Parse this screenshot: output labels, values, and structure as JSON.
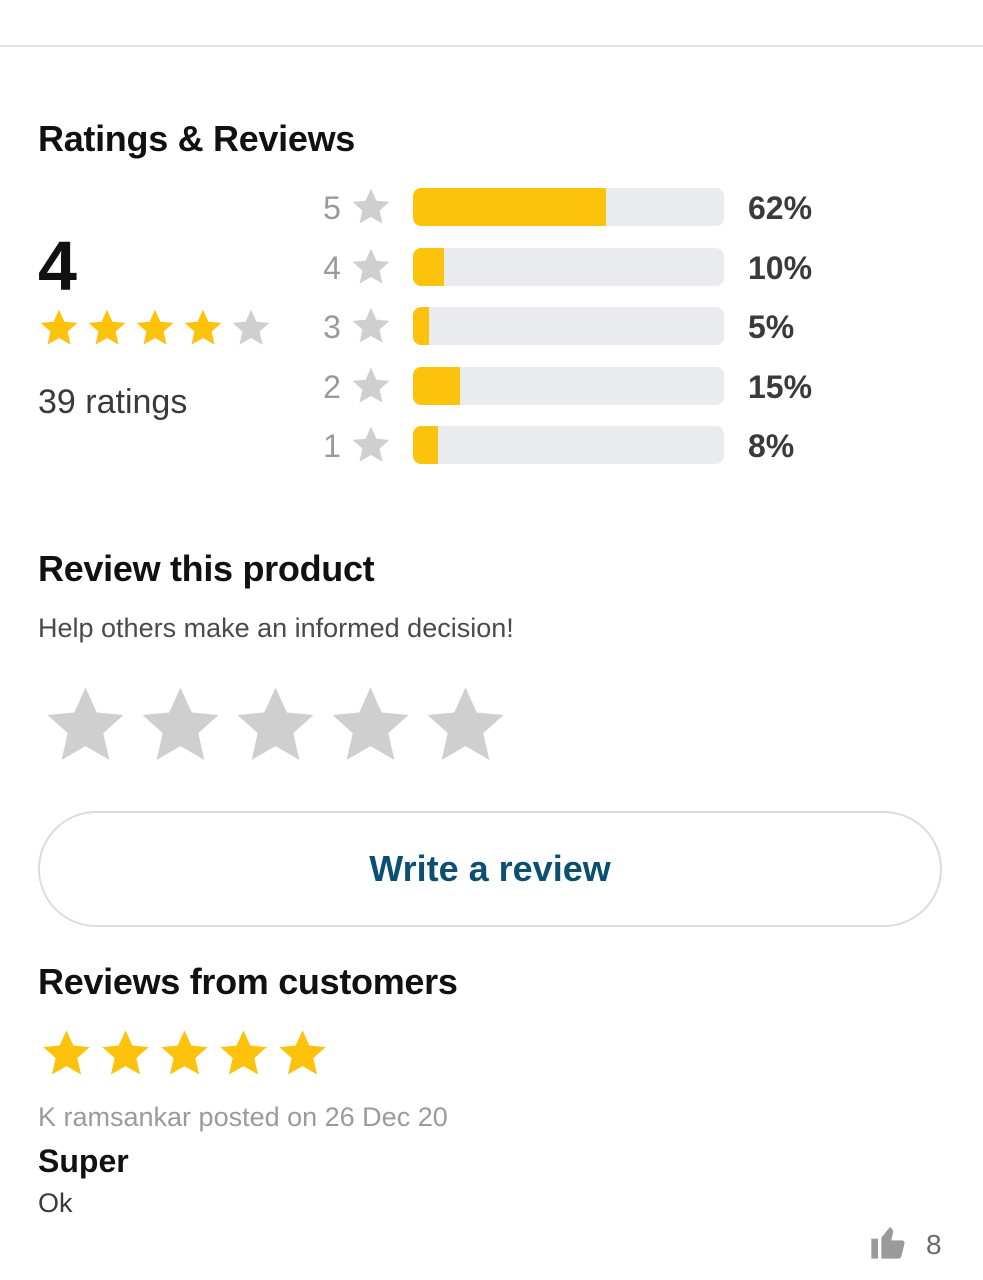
{
  "colors": {
    "accent_yellow": "#fcc20c",
    "star_empty": "#cfcfcf",
    "bar_track": "#e9ebee",
    "button_text": "#0b4f72"
  },
  "ratings": {
    "title": "Ratings & Reviews",
    "average": "4",
    "average_stars_filled": 4,
    "average_stars_total": 5,
    "count_label": "39 ratings",
    "breakdown": [
      {
        "stars": "5",
        "percent": 62,
        "percent_label": "62%"
      },
      {
        "stars": "4",
        "percent": 10,
        "percent_label": "10%"
      },
      {
        "stars": "3",
        "percent": 5,
        "percent_label": "5%"
      },
      {
        "stars": "2",
        "percent": 15,
        "percent_label": "15%"
      },
      {
        "stars": "1",
        "percent": 8,
        "percent_label": "8%"
      }
    ]
  },
  "review_product": {
    "title": "Review this product",
    "subtitle": "Help others make an informed decision!",
    "input_stars": 5,
    "write_button_label": "Write a review"
  },
  "customer_reviews": {
    "title": "Reviews from customers",
    "items": [
      {
        "stars": 5,
        "meta": "K ramsankar posted on 26 Dec 20",
        "title": "Super",
        "body": "Ok",
        "helpful_icon": "thumbs-up-icon",
        "helpful_count": "8"
      }
    ]
  }
}
